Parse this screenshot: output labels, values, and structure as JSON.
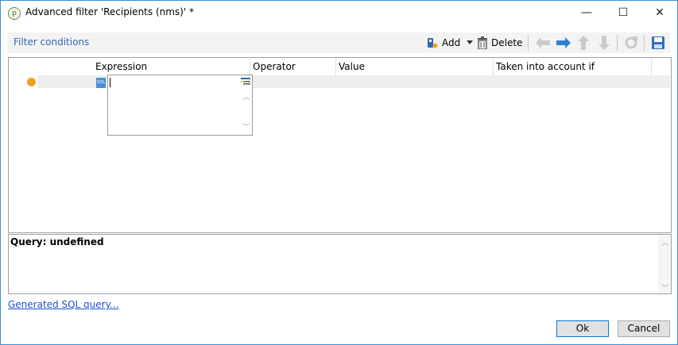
{
  "window": {
    "title": "Advanced filter 'Recipients (nms)' *",
    "minimize_glyph": "—",
    "maximize_glyph": "☐",
    "close_glyph": "✕"
  },
  "toolbar": {
    "label": "Filter conditions",
    "add_label": "Add",
    "delete_label": "Delete"
  },
  "grid": {
    "columns": [
      "Expression",
      "Operator",
      "Value",
      "Taken into account if"
    ],
    "row_marker_color": "#f0a020",
    "sql_icon_text": "SQL"
  },
  "query": {
    "text": "Query: undefined"
  },
  "link": {
    "generated_sql": "Generated SQL query..."
  },
  "buttons": {
    "ok": "Ok",
    "cancel": "Cancel"
  },
  "colors": {
    "accent": "#2e67b1",
    "window_border": "#3c8fcf",
    "link": "#1e52c9"
  }
}
